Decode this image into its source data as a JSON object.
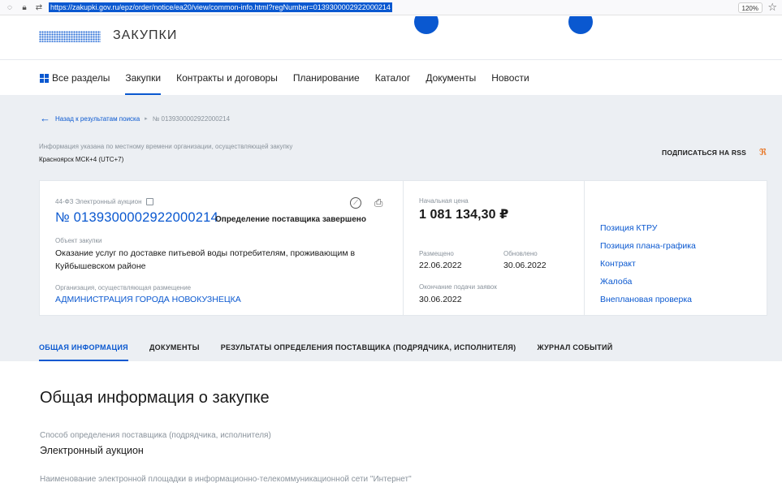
{
  "browser": {
    "url": "https://zakupki.gov.ru/epz/order/notice/ea20/view/common-info.html?regNumber=0139300002922000214",
    "zoom": "120%"
  },
  "header": {
    "logo_text": "ЗАКУПКИ"
  },
  "nav": {
    "all_sections": "Все разделы",
    "items": [
      "Закупки",
      "Контракты и договоры",
      "Планирование",
      "Каталог",
      "Документы",
      "Новости"
    ]
  },
  "breadcrumb": {
    "back": "Назад к результатам поиска",
    "current": "№ 0139300002922000214"
  },
  "tz": {
    "info": "Информация указана по местному времени организации, осуществляющей закупку",
    "value": "Красноярск МСК+4 (UTC+7)"
  },
  "subscribe": "ПОДПИСАТЬСЯ НА RSS",
  "card": {
    "law": "44-ФЗ Электронный аукцион",
    "reg_number": "№ 0139300002922000214",
    "status": "Определение поставщика завершено",
    "object_label": "Объект закупки",
    "object_text": "Оказание услуг по доставке питьевой воды потребителям, проживающим в Куйбышевском районе",
    "org_label": "Организация, осуществляющая размещение",
    "org_text": "АДМИНИСТРАЦИЯ ГОРОДА НОВОКУЗНЕЦКА",
    "price_label": "Начальная цена",
    "price": "1 081 134,30 ₽",
    "posted_label": "Размещено",
    "posted": "22.06.2022",
    "updated_label": "Обновлено",
    "updated": "30.06.2022",
    "end_label": "Окончание подачи заявок",
    "end": "30.06.2022",
    "links": [
      "Позиция КТРУ",
      "Позиция плана-графика",
      "Контракт",
      "Жалоба",
      "Внеплановая проверка"
    ]
  },
  "tabs": [
    "ОБЩАЯ ИНФОРМАЦИЯ",
    "ДОКУМЕНТЫ",
    "РЕЗУЛЬТАТЫ ОПРЕДЕЛЕНИЯ ПОСТАВЩИКА (ПОДРЯДЧИКА, ИСПОЛНИТЕЛЯ)",
    "ЖУРНАЛ СОБЫТИЙ"
  ],
  "content": {
    "title": "Общая информация о закупке",
    "field1_label": "Способ определения поставщика (подрядчика, исполнителя)",
    "field1_value": "Электронный аукцион",
    "field2_label": "Наименование электронной площадки в информационно-телекоммуникационной сети \"Интернет\""
  },
  "colors": {
    "accent": "#0a58d0",
    "rss": "#e8711c",
    "gray_bg": "#eceff3"
  }
}
